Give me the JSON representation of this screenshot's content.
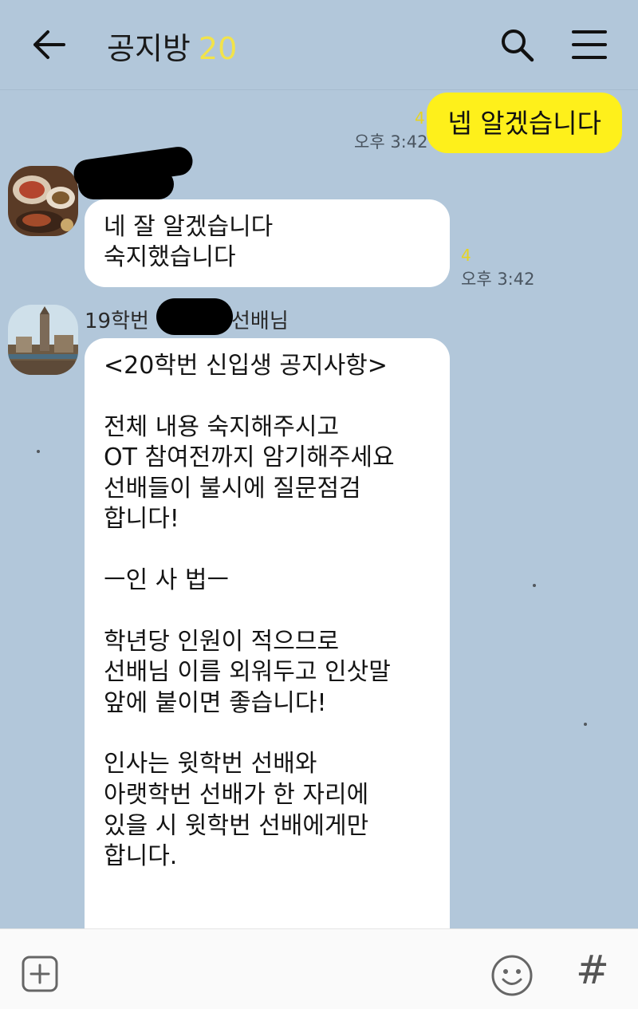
{
  "header": {
    "title": "공지방",
    "member_count": "20",
    "icons": {
      "back": "back-arrow-icon",
      "search": "search-icon",
      "menu": "menu-icon"
    }
  },
  "messages": [
    {
      "from": "me",
      "text": "넵 알겠습니다",
      "unread": "4",
      "time": "오후 3:42"
    },
    {
      "from": "other",
      "lines": [
        "네 잘 알겠습니다",
        "숙지했습니다"
      ],
      "unread": "4",
      "time": "오후 3:42"
    },
    {
      "from": "other",
      "sender_prefix": "19학번",
      "sender_suffix": "선배님",
      "lines": [
        "<20학번 신입생 공지사항>",
        "",
        "전체 내용 숙지해주시고",
        "OT 참여전까지 암기해주세요",
        "선배들이 불시에 질문점검",
        "합니다!",
        "",
        "ㅡ인 사 법ㅡ",
        "",
        "학년당 인원이 적으므로",
        "선배님 이름 외워두고 인삿말",
        "앞에 붙이면 좋습니다!",
        "",
        "인사는 윗학번 선배와",
        "아랫학번 선배가 한 자리에",
        "있을 시 윗학번 선배에게만",
        "합니다."
      ]
    }
  ],
  "bottom_bar": {
    "hash_label": "#",
    "icons": {
      "attach": "plus-icon",
      "emoji": "emoji-icon",
      "hashtag": "hashtag-icon"
    }
  },
  "colors": {
    "background": "#b2c7da",
    "my_bubble": "#fef01b",
    "unread": "#e6d321",
    "member_count": "#f2e34a"
  }
}
